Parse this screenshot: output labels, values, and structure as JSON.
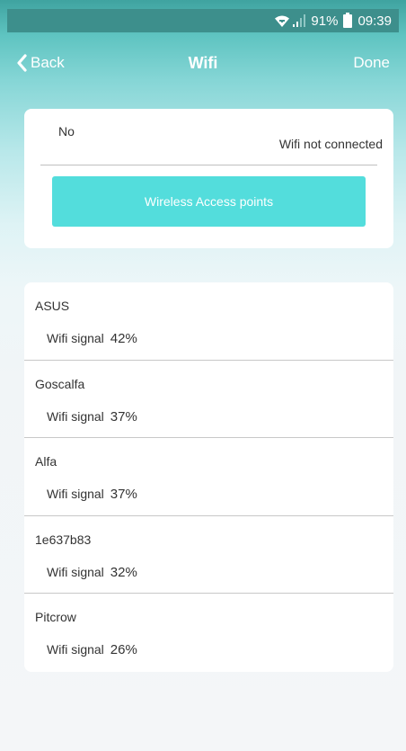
{
  "status_bar": {
    "battery": "91%",
    "time": "09:39"
  },
  "nav": {
    "back_label": "Back",
    "title": "Wifi",
    "done_label": "Done"
  },
  "wifi_status": {
    "label": "No",
    "value": "Wifi not connected",
    "button_label": "Wireless Access points"
  },
  "networks": [
    {
      "name": "ASUS",
      "signal_label": "Wifi signal",
      "signal": "42%"
    },
    {
      "name": "Goscalfa",
      "signal_label": "Wifi signal",
      "signal": "37%"
    },
    {
      "name": "Alfa",
      "signal_label": "Wifi signal",
      "signal": "37%"
    },
    {
      "name": "1e637b83",
      "signal_label": "Wifi signal",
      "signal": "32%"
    },
    {
      "name": "Pitcrow",
      "signal_label": "Wifi signal",
      "signal": "26%"
    }
  ],
  "colors": {
    "accent": "#53dddc",
    "header": "#3d8f8c"
  }
}
